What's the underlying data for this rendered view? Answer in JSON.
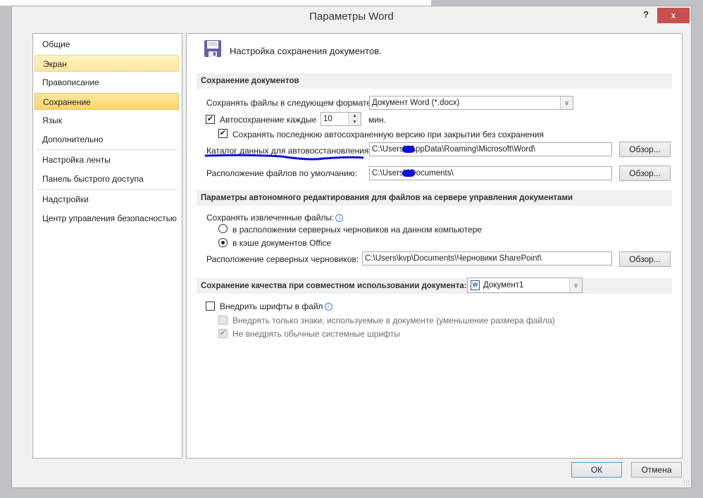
{
  "window": {
    "title": "Параметры Word",
    "help": "?",
    "close": "x"
  },
  "nav": [
    "Общие",
    "Экран",
    "Правописание",
    "Сохранение",
    "Язык",
    "Дополнительно",
    "Настройка ленты",
    "Панель быстрого доступа",
    "Надстройки",
    "Центр управления безопасностью"
  ],
  "header": "Настройка сохранения документов.",
  "save": {
    "section": "Сохранение документов",
    "format_label": "Сохранять файлы в следующем формате:",
    "format_value": "Документ Word (*.docx)",
    "autosave_label": "Автосохранение каждые",
    "autosave_value": "10",
    "autosave_unit": "мин.",
    "keep_last_label": "Сохранять последнюю автосохраненную версию при закрытии без сохранения",
    "autorecover_label": "Каталог данных для автовосстановления:",
    "autorecover_value": "C:\\Users\\      \\AppData\\Roaming\\Microsoft\\Word\\",
    "default_label": "Расположение файлов по умолчанию:",
    "default_value": "C:\\Users\\      \\Documents\\",
    "browse": "Обзор..."
  },
  "offline": {
    "section": "Параметры автономного редактирования для файлов на сервере управления документами",
    "save_checked_label": "Сохранять извлеченные файлы:",
    "opt1": "в расположении серверных черновиков на данном компьютере",
    "opt2": "в кэше документов Office",
    "drafts_label": "Расположение серверных черновиков:",
    "drafts_value": "C:\\Users\\kvp\\Documents\\Черновики SharePoint\\",
    "browse": "Обзор..."
  },
  "fidelity": {
    "section": "Сохранение качества при совместном использовании документа:",
    "doc_value": "Документ1",
    "embed_label": "Внедрить шрифты в файл",
    "only_used_label": "Внедрять только знаки, используемые в документе (уменьшение размера файла)",
    "no_system_label": "Не внедрять обычные системные шрифты"
  },
  "footer": {
    "ok": "ОК",
    "cancel": "Отмена"
  }
}
